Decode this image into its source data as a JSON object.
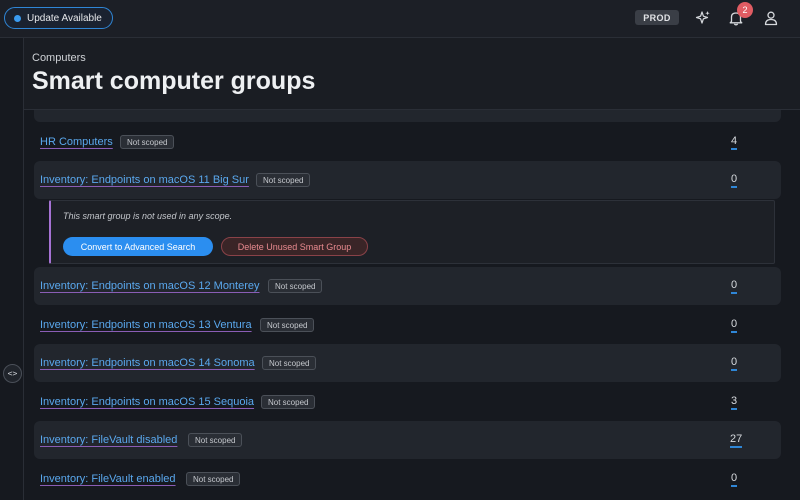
{
  "topbar": {
    "update_label": "Update Available",
    "env_label": "PROD",
    "notification_count": "2",
    "icons": [
      "sparkle-icon",
      "bell-icon",
      "user-icon"
    ]
  },
  "header": {
    "breadcrumb": "Computers",
    "title": "Smart computer groups"
  },
  "groups": [
    {
      "name": "HR Computers",
      "scope": "Not scoped",
      "count": "4"
    },
    {
      "name": "Inventory: Endpoints on macOS 11 Big Sur",
      "scope": "Not scoped",
      "count": "0"
    },
    {
      "name": "Inventory: Endpoints on macOS 12 Monterey",
      "scope": "Not scoped",
      "count": "0"
    },
    {
      "name": "Inventory: Endpoints on macOS 13 Ventura",
      "scope": "Not scoped",
      "count": "0"
    },
    {
      "name": "Inventory: Endpoints on macOS 14 Sonoma",
      "scope": "Not scoped",
      "count": "0"
    },
    {
      "name": "Inventory: Endpoints on macOS 15 Sequoia",
      "scope": "Not scoped",
      "count": "3"
    },
    {
      "name": "Inventory: FileVault disabled",
      "scope": "Not scoped",
      "count": "27"
    },
    {
      "name": "Inventory: FileVault enabled",
      "scope": "Not scoped",
      "count": "0"
    }
  ],
  "detail": {
    "message": "This smart group is not used in any scope.",
    "convert_label": "Convert to Advanced Search",
    "delete_label": "Delete Unused Smart Group"
  },
  "colors": {
    "accent": "#2b8ef0",
    "link": "#5aa8ee",
    "danger": "#e88a8f",
    "notification": "#e05c63"
  }
}
